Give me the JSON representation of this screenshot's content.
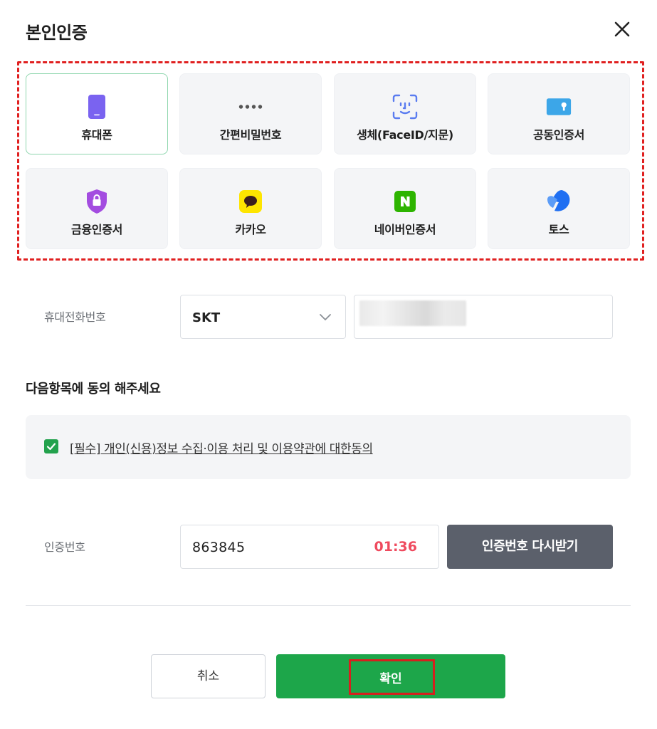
{
  "dialog": {
    "title": "본인인증"
  },
  "methods": [
    {
      "label": "휴대폰",
      "icon": "phone-icon",
      "selected": true
    },
    {
      "label": "간편비밀번호",
      "icon": "pin-dots-icon",
      "selected": false
    },
    {
      "label": "생체(FaceID/지문)",
      "icon": "face-id-icon",
      "selected": false
    },
    {
      "label": "공동인증서",
      "icon": "certificate-card-icon",
      "selected": false
    },
    {
      "label": "금융인증서",
      "icon": "shield-lock-icon",
      "selected": false
    },
    {
      "label": "카카오",
      "icon": "kakao-icon",
      "selected": false
    },
    {
      "label": "네이버인증서",
      "icon": "naver-icon",
      "selected": false
    },
    {
      "label": "토스",
      "icon": "toss-icon",
      "selected": false
    }
  ],
  "phone": {
    "label": "휴대전화번호",
    "carrier": "SKT"
  },
  "consent": {
    "heading": "다음항목에 동의 해주세요",
    "item": "[필수] 개인(신용)정보 수집·이용 처리 및 이용약관에 대한동의",
    "checked": true
  },
  "verification": {
    "label": "인증번호",
    "code": "863845",
    "timer": "01:36",
    "resend_label": "인증번호 다시받기"
  },
  "actions": {
    "cancel_label": "취소",
    "confirm_label": "확인"
  },
  "colors": {
    "accent_green": "#1da64a",
    "timer_red": "#ef4a5e",
    "resend_gray": "#5b606b",
    "highlight_red": "#e02020"
  }
}
